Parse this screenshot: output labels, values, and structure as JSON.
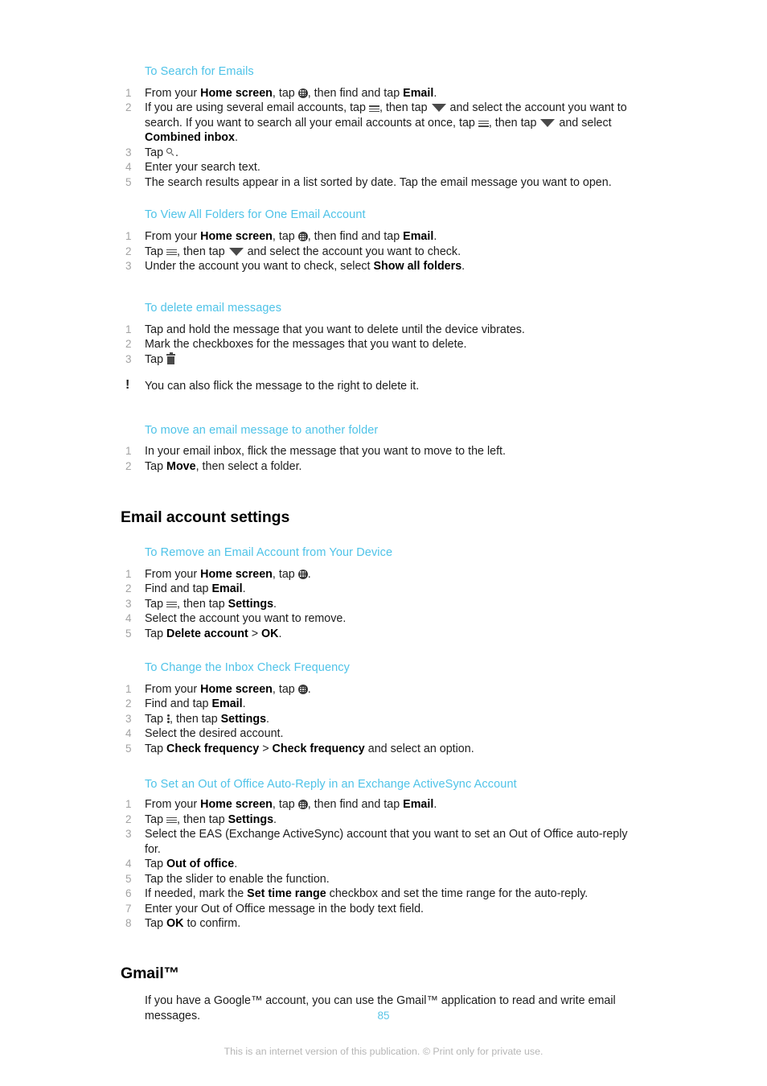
{
  "document": {
    "page_number": "85",
    "legal_notice": "This is an internet version of this publication. © Print only for private use."
  },
  "sections": [
    {
      "heading": "To Search for Emails",
      "steps": [
        "From your Home screen, tap [apps-icon], then find and tap Email.",
        "If you are using several email accounts, tap [menu-icon], then tap [caret-icon] and select the account you want to search. If you want to search all your email accounts at once, tap [menu-icon], then tap [caret-icon] and select Combined inbox.",
        "Tap [search-icon].",
        "Enter your search text.",
        "The search results appear in a list sorted by date. Tap the email message you want to open."
      ]
    },
    {
      "heading": "To View All Folders for One Email Account",
      "steps": [
        "From your Home screen, tap [apps-icon], then find and tap Email.",
        "Tap [menu-icon], then tap [caret-icon] and select the account you want to check.",
        "Under the account you want to check, select Show all folders."
      ]
    },
    {
      "heading": "To delete email messages",
      "steps": [
        "Tap and hold the message that you want to delete until the device vibrates.",
        "Mark the checkboxes for the messages that you want to delete.",
        "Tap [trash-icon]"
      ],
      "tip": "You can also flick the message to the right to delete it."
    },
    {
      "heading": "To move an email message to another folder",
      "steps": [
        "In your email inbox, flick the message that you want to move to the left.",
        "Tap Move, then select a folder."
      ]
    }
  ],
  "email_account_settings": {
    "title": "Email account settings",
    "sections": [
      {
        "heading": "To Remove an Email Account from Your Device",
        "steps": [
          "From your Home screen, tap [apps-icon].",
          "Find and tap Email.",
          "Tap [menu-icon], then tap Settings.",
          "Select the account you want to remove.",
          "Tap Delete account > OK."
        ]
      },
      {
        "heading": "To Change the Inbox Check Frequency",
        "steps": [
          "From your Home screen, tap [apps-icon].",
          "Find and tap Email.",
          "Tap [kebab-icon], then tap Settings.",
          "Select the desired account.",
          "Tap Check frequency > Check frequency and select an option."
        ]
      },
      {
        "heading": "To Set an Out of Office Auto-Reply in an Exchange ActiveSync Account",
        "steps": [
          "From your Home screen, tap [apps-icon], then find and tap Email.",
          "Tap [menu-icon], then tap Settings.",
          "Select the EAS (Exchange ActiveSync) account that you want to set an Out of Office auto-reply for.",
          "Tap Out of office.",
          "Tap the slider to enable the function.",
          "If needed, mark the Set time range checkbox and set the time range for the auto-reply.",
          "Enter your Out of Office message in the body text field.",
          "Tap OK to confirm."
        ]
      }
    ]
  },
  "gmail": {
    "title": "Gmail™",
    "body": "If you have a Google™ account, you can use the Gmail™ application to read and write email messages."
  },
  "colors": {
    "heading_blue": "#4FC3E8",
    "body_text": "#1d1d1d",
    "step_number": "#a3a3a3",
    "legal_text": "#b6b6b6"
  },
  "icons": {
    "apps": "app-drawer-icon",
    "menu": "hamburger-menu-icon",
    "caret": "caret-down-icon",
    "search": "search-icon",
    "trash": "trash-icon",
    "kebab": "overflow-menu-icon",
    "tip": "tip-exclamation-icon"
  }
}
